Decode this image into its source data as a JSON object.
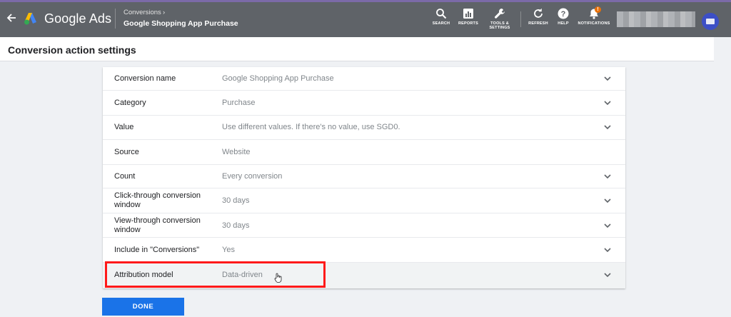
{
  "header": {
    "brand": "Google Ads",
    "breadcrumb_parent": "Conversions",
    "breadcrumb_chevron": "›",
    "breadcrumb_current": "Google Shopping App Purchase",
    "tools": [
      {
        "label": "SEARCH",
        "icon": "search-icon"
      },
      {
        "label": "REPORTS",
        "icon": "reports-icon"
      },
      {
        "label": "TOOLS &\nSETTINGS",
        "icon": "wrench-icon"
      },
      {
        "label": "REFRESH",
        "icon": "refresh-icon"
      },
      {
        "label": "HELP",
        "icon": "help-icon"
      },
      {
        "label": "NOTIFICATIONS",
        "icon": "bell-icon"
      }
    ],
    "notification_badge": "!",
    "colors": {
      "bar": "#5f6368",
      "accent": "#1a73e8",
      "highlight_box": "#ff1a1a"
    }
  },
  "page": {
    "title": "Conversion action settings"
  },
  "settings": [
    {
      "label": "Conversion name",
      "value": "Google Shopping App Purchase",
      "expandable": true
    },
    {
      "label": "Category",
      "value": "Purchase",
      "expandable": true
    },
    {
      "label": "Value",
      "value": "Use different values. If there's no value, use SGD0.",
      "expandable": true
    },
    {
      "label": "Source",
      "value": "Website",
      "expandable": false
    },
    {
      "label": "Count",
      "value": "Every conversion",
      "expandable": true
    },
    {
      "label": "Click-through conversion window",
      "value": "30 days",
      "expandable": true
    },
    {
      "label": "View-through conversion window",
      "value": "30 days",
      "expandable": true
    },
    {
      "label": "Include in \"Conversions\"",
      "value": "Yes",
      "expandable": true
    },
    {
      "label": "Attribution model",
      "value": "Data-driven",
      "expandable": true
    }
  ],
  "done_button": "DONE"
}
